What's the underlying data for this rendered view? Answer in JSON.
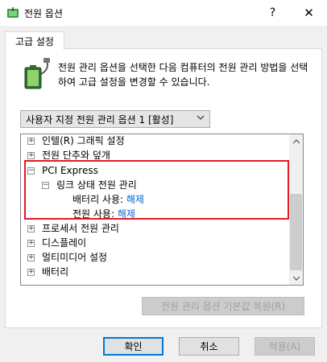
{
  "window": {
    "title": "전원 옵션",
    "help_glyph": "?",
    "close_glyph": "✕"
  },
  "tab": {
    "label": "고급 설정"
  },
  "description": "전원 관리 옵션을 선택한 다음 컴퓨터의 전원 관리 방법을 선택하여 고급 설정을 변경할 수 있습니다.",
  "plan_select": {
    "value": "사용자 지정 전원 관리 옵션 1 [활성]"
  },
  "tree": {
    "intel_graphics": "인텔(R) 그래픽 설정",
    "power_button": "전원 단추와 덮개",
    "pci_express": "PCI Express",
    "link_state": "링크 상태 전원 관리",
    "battery_label": "배터리 사용:",
    "battery_value": "해제",
    "plugged_label": "전원 사용:",
    "plugged_value": "해제",
    "processor": "프로세서 전원 관리",
    "display": "디스플레이",
    "multimedia": "멀티미디어 설정",
    "battery": "배터리",
    "collapsed_glyph": "+",
    "expanded_glyph": "−"
  },
  "buttons": {
    "restore": "전원 관리 옵션 기본값 복원(R)",
    "ok": "확인",
    "cancel": "취소",
    "apply": "적용(A)"
  },
  "colors": {
    "highlight": "#e01c24",
    "link": "#0066cc"
  }
}
